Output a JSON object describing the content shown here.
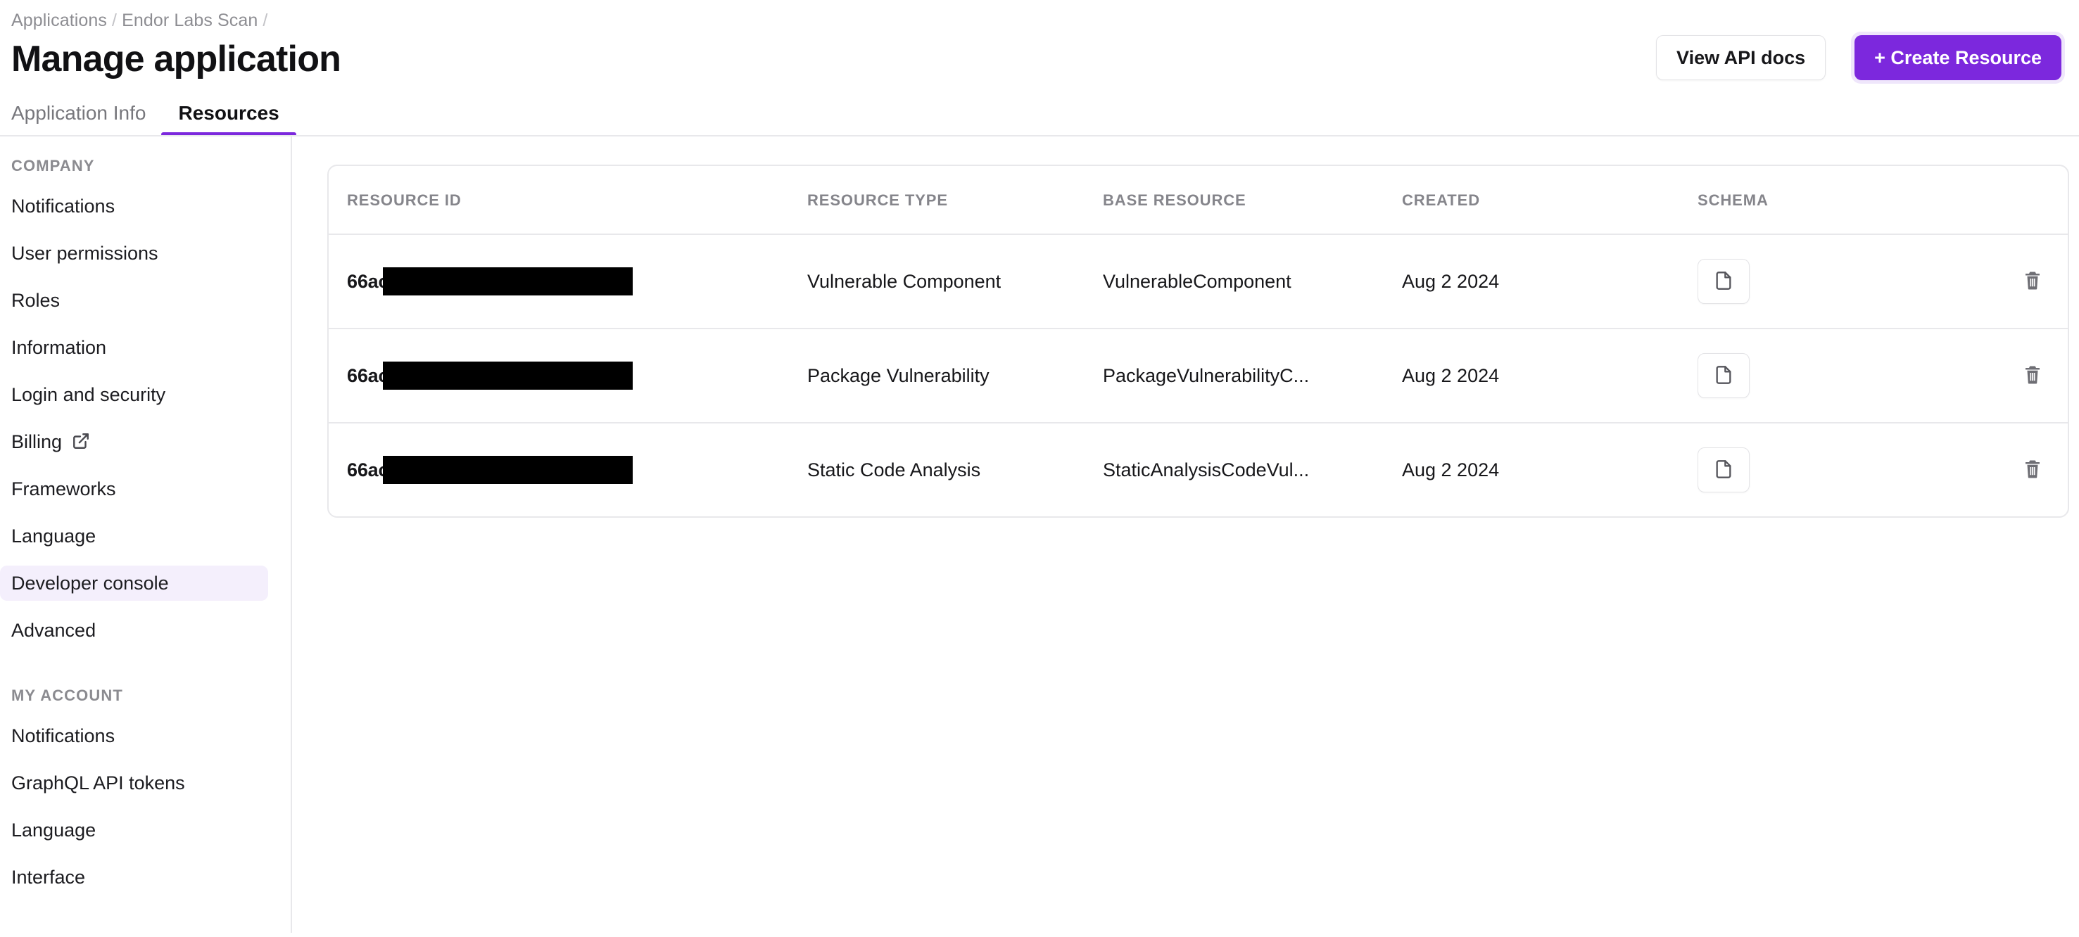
{
  "breadcrumb": {
    "items": [
      "Applications",
      "Endor Labs Scan"
    ],
    "separator": "/",
    "trailing_separator": "/"
  },
  "header": {
    "title": "Manage application",
    "view_api_docs_label": "View API docs",
    "create_resource_label": "+ Create Resource"
  },
  "tabs": [
    {
      "label": "Application Info",
      "active": false
    },
    {
      "label": "Resources",
      "active": true
    }
  ],
  "sidebar": {
    "sections": [
      {
        "label": "COMPANY",
        "items": [
          {
            "label": "Notifications",
            "active": false,
            "external": false
          },
          {
            "label": "User permissions",
            "active": false,
            "external": false
          },
          {
            "label": "Roles",
            "active": false,
            "external": false
          },
          {
            "label": "Information",
            "active": false,
            "external": false
          },
          {
            "label": "Login and security",
            "active": false,
            "external": false
          },
          {
            "label": "Billing",
            "active": false,
            "external": true
          },
          {
            "label": "Frameworks",
            "active": false,
            "external": false
          },
          {
            "label": "Language",
            "active": false,
            "external": false
          },
          {
            "label": "Developer console",
            "active": true,
            "external": false
          },
          {
            "label": "Advanced",
            "active": false,
            "external": false
          }
        ]
      },
      {
        "label": "MY ACCOUNT",
        "items": [
          {
            "label": "Notifications",
            "active": false,
            "external": false
          },
          {
            "label": "GraphQL API tokens",
            "active": false,
            "external": false
          },
          {
            "label": "Language",
            "active": false,
            "external": false
          },
          {
            "label": "Interface",
            "active": false,
            "external": false
          }
        ]
      }
    ]
  },
  "table": {
    "columns": [
      "RESOURCE ID",
      "RESOURCE TYPE",
      "BASE RESOURCE",
      "CREATED",
      "SCHEMA",
      ""
    ],
    "rows": [
      {
        "resource_id_prefix": "66ac",
        "resource_id_redacted": true,
        "resource_type": "Vulnerable Component",
        "base_resource": "VulnerableComponent",
        "created": "Aug 2 2024",
        "schema_icon": "document-icon",
        "delete_icon": "trash-icon"
      },
      {
        "resource_id_prefix": "66ac",
        "resource_id_redacted": true,
        "resource_type": "Package Vulnerability",
        "base_resource": "PackageVulnerabilityC...",
        "created": "Aug 2 2024",
        "schema_icon": "document-icon",
        "delete_icon": "trash-icon"
      },
      {
        "resource_id_prefix": "66ac",
        "resource_id_redacted": true,
        "resource_type": "Static Code Analysis",
        "base_resource": "StaticAnalysisCodeVul...",
        "created": "Aug 2 2024",
        "schema_icon": "document-icon",
        "delete_icon": "trash-icon"
      }
    ]
  },
  "colors": {
    "accent_purple": "#7C28DD",
    "accent_purple_soft": "#F4EFFC",
    "border_grey": "#E8E8EB",
    "text_primary": "#17171A",
    "text_muted": "#85858B"
  }
}
